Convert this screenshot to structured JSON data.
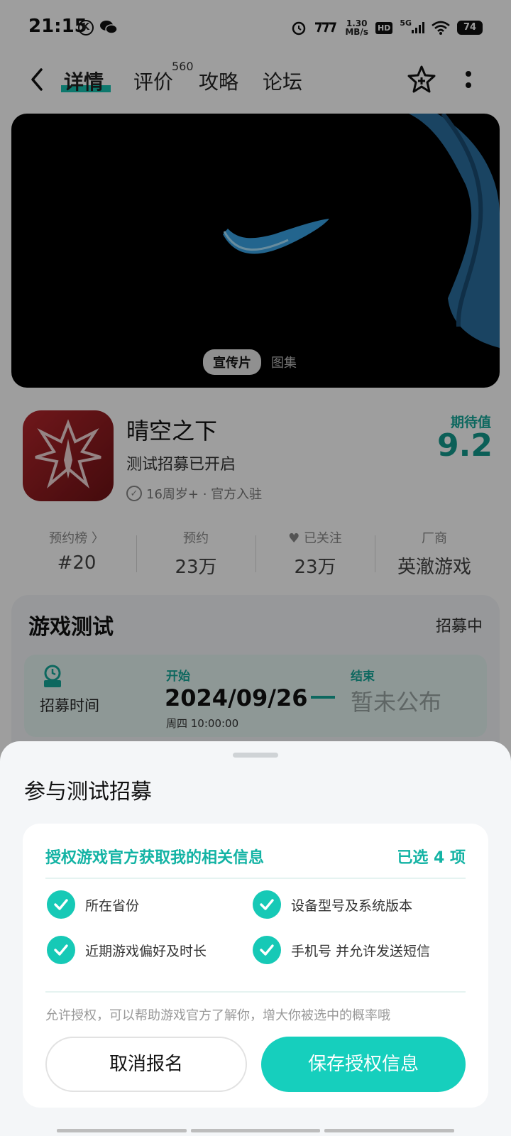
{
  "status_bar": {
    "time": "21:15",
    "net_speed_value": "1.30",
    "net_speed_unit": "MB/s",
    "hd": "HD",
    "network": "5G",
    "battery": "74"
  },
  "nav": {
    "tabs": [
      {
        "label": "详情"
      },
      {
        "label": "评价"
      },
      {
        "label": "攻略"
      },
      {
        "label": "论坛"
      }
    ],
    "review_count": "560"
  },
  "media": {
    "tabs": [
      "宣传片",
      "图集"
    ]
  },
  "app": {
    "name": "晴空之下",
    "subtitle": "测试招募已开启",
    "meta": "16周岁+ · 官方入驻",
    "expect_label": "期待值",
    "expect_value": "9.2"
  },
  "stats": [
    {
      "label": "预约榜 〉",
      "value": "#20"
    },
    {
      "label": "预约",
      "value": "23万"
    },
    {
      "label": "已关注",
      "value": "23万"
    },
    {
      "label": "厂商",
      "value": "英澈游戏"
    }
  ],
  "game_test": {
    "title": "游戏测试",
    "status": "招募中",
    "label": "招募时间",
    "start_label": "开始",
    "start_date": "2024/09/26",
    "start_sub": "周四  10:00:00",
    "end_label": "结束",
    "end_value": "暂未公布"
  },
  "sheet": {
    "title": "参与测试招募",
    "auth_title": "授权游戏官方获取我的相关信息",
    "selected": "已选 4 项",
    "options": [
      {
        "label": "所在省份"
      },
      {
        "label": "设备型号及系统版本"
      },
      {
        "label": "近期游戏偏好及时长"
      },
      {
        "label": "手机号 并允许发送短信"
      }
    ],
    "hint": "允许授权，可以帮助游戏官方了解你，增大你被选中的概率哦",
    "cancel": "取消报名",
    "save": "保存授权信息"
  },
  "colors": {
    "accent": "#16cfbd",
    "accent_text": "#13b3a4"
  }
}
